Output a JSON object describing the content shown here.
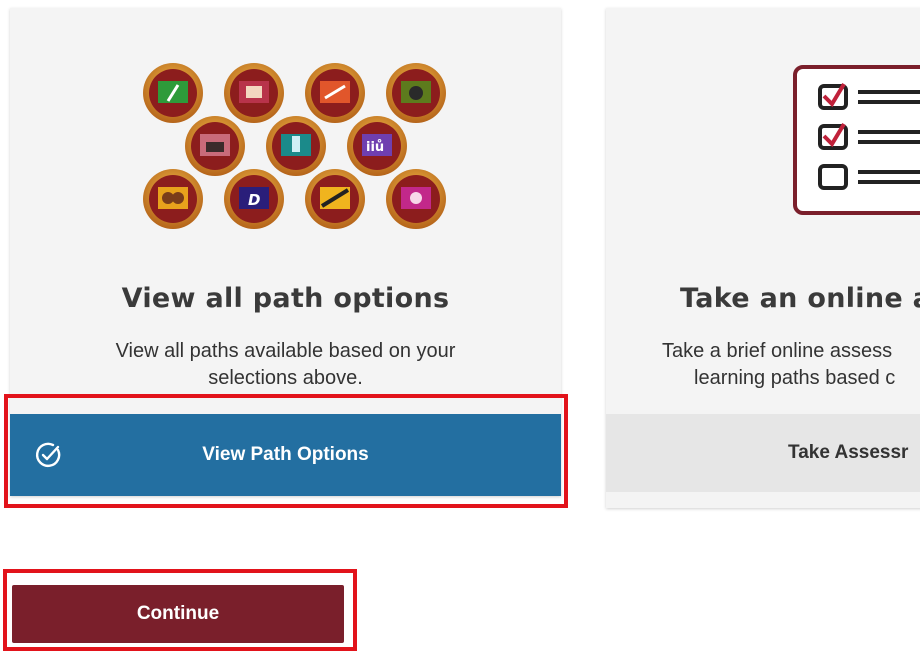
{
  "cards": [
    {
      "title": "View all path options",
      "description": "View all paths available based on your selections above.",
      "button_label": "View Path Options",
      "button_icon": "check-circle-icon"
    },
    {
      "title": "Take an online a",
      "description_line1": "Take a brief online assess",
      "description_line2": "learning paths based c",
      "button_label": "Take Assessr",
      "illustration": "checklist-icon"
    }
  ],
  "continue_label": "Continue",
  "badges": [
    "microphone",
    "castle",
    "telescope",
    "crowd",
    "audience",
    "trophy",
    "people",
    "theater-masks",
    "letter-d",
    "road-signs",
    "handshake"
  ],
  "colors": {
    "primary_blue": "#236fa1",
    "maroon": "#7a1f2b",
    "highlight_red": "#e2131b",
    "badge_ring": "#d8891c"
  }
}
